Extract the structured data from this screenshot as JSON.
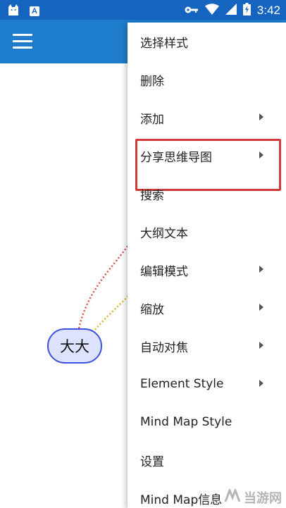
{
  "status_bar": {
    "time": "3:42",
    "left_icons": [
      "cat-icon",
      "a-icon"
    ],
    "a_icon_letter": "A",
    "right_icons": [
      "key-icon",
      "wifi-icon",
      "signal-icon",
      "battery-icon"
    ]
  },
  "app_bar": {
    "menu_icon": "hamburger-icon",
    "color": "#1e7ccc"
  },
  "mind_map": {
    "node_label": "大大"
  },
  "menu": {
    "items": [
      {
        "label": "选择样式",
        "has_submenu": false
      },
      {
        "label": "删除",
        "has_submenu": false
      },
      {
        "label": "添加",
        "has_submenu": true
      },
      {
        "label": "分享思维导图",
        "has_submenu": true,
        "highlighted": true
      },
      {
        "label": "搜索",
        "has_submenu": false
      },
      {
        "label": "大纲文本",
        "has_submenu": false
      },
      {
        "label": "编辑模式",
        "has_submenu": true
      },
      {
        "label": "缩放",
        "has_submenu": true
      },
      {
        "label": "自动对焦",
        "has_submenu": true
      },
      {
        "label": "Element Style",
        "has_submenu": true
      },
      {
        "label": "Mind Map Style",
        "has_submenu": false
      },
      {
        "label": "设置",
        "has_submenu": false
      },
      {
        "label": "Mind Map信息",
        "has_submenu": false
      }
    ]
  },
  "watermark": {
    "text": "当游网"
  }
}
